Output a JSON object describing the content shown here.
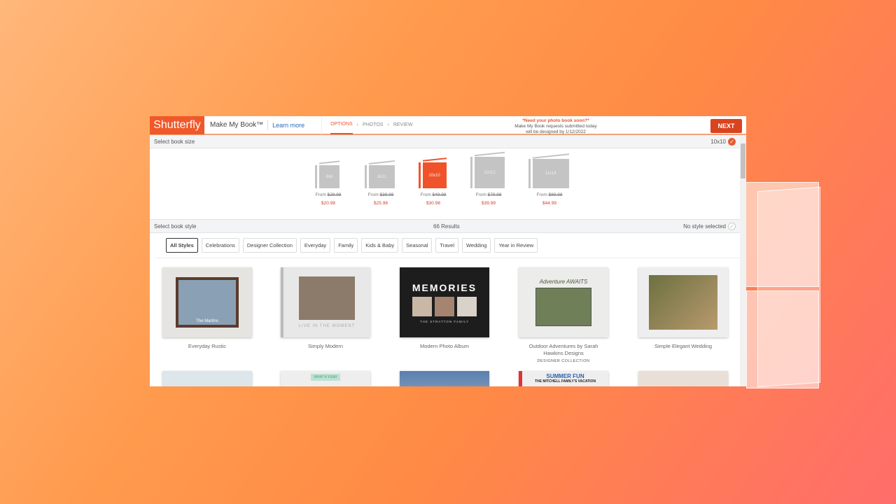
{
  "header": {
    "logo": "Shutterfly",
    "product": "Make My Book™",
    "learn_more": "Learn more",
    "steps": [
      "OPTIONS",
      "PHOTOS",
      "REVIEW"
    ],
    "active_step": "OPTIONS",
    "notice_title": "*Need your photo book soon?*",
    "notice_line1": "Make My Book requests submitted today",
    "notice_line2": "will be designed by 1/12/2022",
    "next": "NEXT"
  },
  "size_bar": {
    "label": "Select book size",
    "selected": "10x10"
  },
  "sizes": [
    {
      "name": "8x8",
      "from_label": "From",
      "old": "$29.98",
      "price": "$20.98"
    },
    {
      "name": "8x11",
      "from_label": "From",
      "old": "$39.98",
      "price": "$25.98"
    },
    {
      "name": "10x10",
      "from_label": "From",
      "old": "$49.98",
      "price": "$30.98"
    },
    {
      "name": "12x12",
      "from_label": "From",
      "old": "$79.98",
      "price": "$39.99"
    },
    {
      "name": "11x14",
      "from_label": "From",
      "old": "$89.98",
      "price": "$44.99"
    }
  ],
  "style_bar": {
    "label": "Select book style",
    "results": "66 Results",
    "status": "No style selected"
  },
  "filters": [
    "All Styles",
    "Celebrations",
    "Designer Collection",
    "Everyday",
    "Family",
    "Kids & Baby",
    "Seasonal",
    "Travel",
    "Wedding",
    "Year in Review"
  ],
  "cards": [
    {
      "title": "Everyday Rustic",
      "cover_text": "The Martins"
    },
    {
      "title": "Simply Modern",
      "cover_text": "LIVE IN THE MOMENT"
    },
    {
      "title": "Modern Photo Album",
      "cover_text": "MEMORIES",
      "cover_sub": "THE STRATTON FAMILY"
    },
    {
      "title": "Outdoor Adventures by Sarah Hawkins Designs",
      "badge": "DESIGNER COLLECTION",
      "cover_text": "Adventure AWAITS"
    },
    {
      "title": "Simple Elegant Wedding"
    }
  ],
  "row2": [
    {
      "cover_text": ""
    },
    {
      "cover_text": "WHAT A YEAR"
    },
    {
      "cover_text": ""
    },
    {
      "cover_text": "SUMMER FUN",
      "cover_sub": "THE MITCHELL FAMILY'S VACATION"
    },
    {
      "cover_text": ""
    }
  ],
  "colors": {
    "brand": "#f0582a",
    "next": "#d9431e",
    "price": "#d43c2a"
  }
}
